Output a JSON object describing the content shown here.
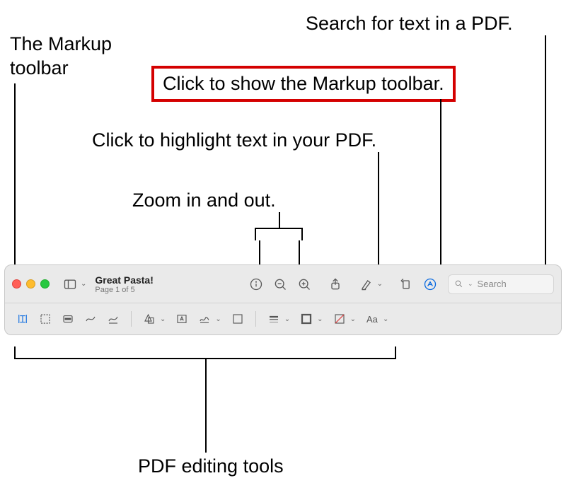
{
  "labels": {
    "markup_toolbar_label": "The Markup toolbar",
    "search_label": "Search for text in a PDF.",
    "show_markup_label": "Click to show the Markup toolbar.",
    "highlight_label": "Click to highlight text in your PDF.",
    "zoom_label": "Zoom in and out.",
    "editing_tools_label": "PDF editing tools"
  },
  "document": {
    "title": "Great Pasta!",
    "subtitle": "Page 1 of 5"
  },
  "search": {
    "placeholder": "Search"
  }
}
